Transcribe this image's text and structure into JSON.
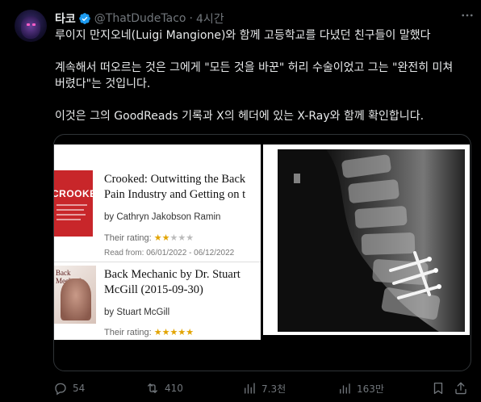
{
  "tweet": {
    "display_name": "타코",
    "handle": "@ThatDudeTaco",
    "time": "4시간",
    "paragraphs": [
      "루이지 만지오네(Luigi Mangione)와 함께 고등학교를 다녔던 친구들이 말했다",
      "계속해서 떠오르는 것은 그에게 \"모든 것을 바꾼\" 허리 수술이었고 그는 \"완전히 미쳐 버렸다\"는 것입니다.",
      "이것은 그의 GoodReads 기록과 X의 헤더에 있는 X-Ray와 함께 확인합니다."
    ]
  },
  "books": [
    {
      "cover_text": "CROOKED",
      "title_line1": "Crooked: Outwitting the Back",
      "title_line2": "Pain Industry and Getting on t",
      "author": "by Cathryn Jakobson Ramin",
      "rating_label": "Their rating:",
      "rating": 2,
      "rating_max": 5,
      "read": "Read from: 06/01/2022 - 06/12/2022"
    },
    {
      "cover_text": "Back Mechanic",
      "title_line1": "Back Mechanic by Dr. Stuart",
      "title_line2": "McGill (2015-09-30)",
      "author": "by Stuart McGill",
      "rating_label": "Their rating:",
      "rating": 5,
      "rating_max": 5
    }
  ],
  "actions": {
    "replies": "54",
    "retweets": "410",
    "views": "7.3천",
    "bookmarks": "163만"
  },
  "colors": {
    "background": "#000000",
    "text": "#e7e9ea",
    "muted": "#71767b",
    "verified": "#1d9bf0",
    "star": "#e2a400",
    "cover_red": "#c8262a"
  }
}
